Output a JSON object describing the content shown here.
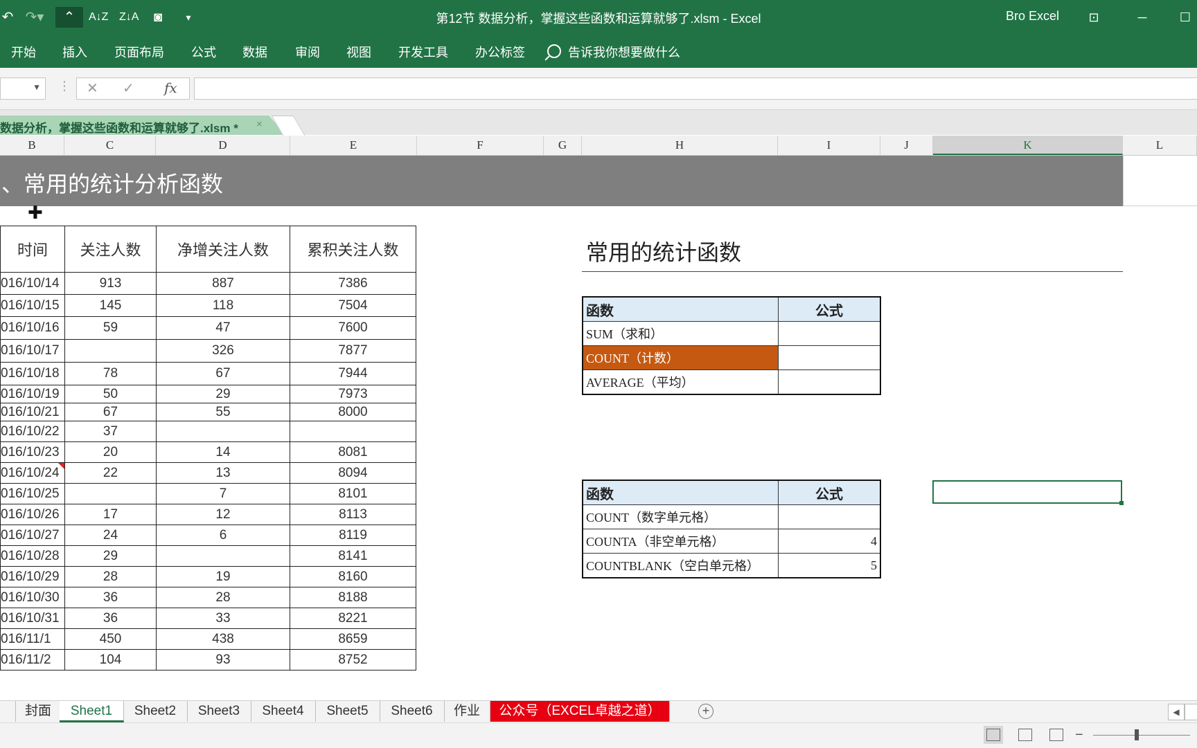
{
  "titlebar": {
    "doc_title": "第12节 数据分析，掌握这些函数和运算就够了.xlsm  -  Excel",
    "user": "Bro Excel",
    "quick_access": [
      "undo-icon",
      "redo-icon",
      "ribbon-collapse-icon",
      "sort-ascending-icon",
      "sort-descending-icon",
      "camera-icon",
      "customize-qat-icon"
    ]
  },
  "ribbon": {
    "tabs": [
      "开始",
      "插入",
      "页面布局",
      "公式",
      "数据",
      "审阅",
      "视图",
      "开发工具",
      "办公标签"
    ],
    "tell_me": "告诉我你想要做什么"
  },
  "formula_bar": {
    "fx": "fx"
  },
  "workbook_tab": {
    "label": "数据分析，掌握这些函数和运算就够了.xlsm *",
    "close": "×"
  },
  "columns": [
    "B",
    "C",
    "D",
    "E",
    "F",
    "G",
    "H",
    "I",
    "J",
    "K",
    "L"
  ],
  "banner": "、常用的统计分析函数",
  "main_table": {
    "headers": [
      "时间",
      "关注人数",
      "净增关注人数",
      "累积关注人数"
    ],
    "rows": [
      [
        "016/10/14",
        "913",
        "887",
        "7386"
      ],
      [
        "016/10/15",
        "145",
        "118",
        "7504"
      ],
      [
        "016/10/16",
        "59",
        "47",
        "7600"
      ],
      [
        "016/10/17",
        "",
        "326",
        "7877"
      ],
      [
        "016/10/18",
        "78",
        "67",
        "7944"
      ],
      [
        "016/10/19",
        "50",
        "29",
        "7973"
      ],
      [
        "016/10/21",
        "67",
        "55",
        "8000"
      ],
      [
        "016/10/22",
        "37",
        "",
        ""
      ],
      [
        "016/10/23",
        "20",
        "14",
        "8081"
      ],
      [
        "016/10/24",
        "22",
        "13",
        "8094"
      ],
      [
        "016/10/25",
        "",
        "7",
        "8101"
      ],
      [
        "016/10/26",
        "17",
        "12",
        "8113"
      ],
      [
        "016/10/27",
        "24",
        "6",
        "8119"
      ],
      [
        "016/10/28",
        "29",
        "",
        "8141"
      ],
      [
        "016/10/29",
        "28",
        "19",
        "8160"
      ],
      [
        "016/10/30",
        "36",
        "28",
        "8188"
      ],
      [
        "016/10/31",
        "36",
        "33",
        "8221"
      ],
      [
        "016/11/1",
        "450",
        "438",
        "8659"
      ],
      [
        "016/11/2",
        "104",
        "93",
        "8752"
      ]
    ]
  },
  "stats": {
    "title": "常用的统计函数",
    "table1": {
      "headers": [
        "函数",
        "公式"
      ],
      "rows": [
        [
          "SUM（求和）",
          ""
        ],
        [
          "COUNT（计数）",
          ""
        ],
        [
          "AVERAGE（平均）",
          ""
        ]
      ]
    },
    "table2": {
      "headers": [
        "函数",
        "公式"
      ],
      "rows": [
        [
          "COUNT（数字单元格）",
          ""
        ],
        [
          "COUNTA（非空单元格）",
          "4"
        ],
        [
          "COUNTBLANK（空白单元格）",
          "5"
        ]
      ]
    },
    "highlight_color": "#c65911"
  },
  "sheets": [
    "封面",
    "Sheet1",
    "Sheet2",
    "Sheet3",
    "Sheet4",
    "Sheet5",
    "Sheet6",
    "作业",
    "公众号（EXCEL卓越之道）"
  ],
  "active_sheet": "Sheet1",
  "colors": {
    "excel_green": "#217346",
    "banner_gray": "#7f7f7f",
    "header_blue": "#ddebf7",
    "red_tab": "#e60012"
  }
}
